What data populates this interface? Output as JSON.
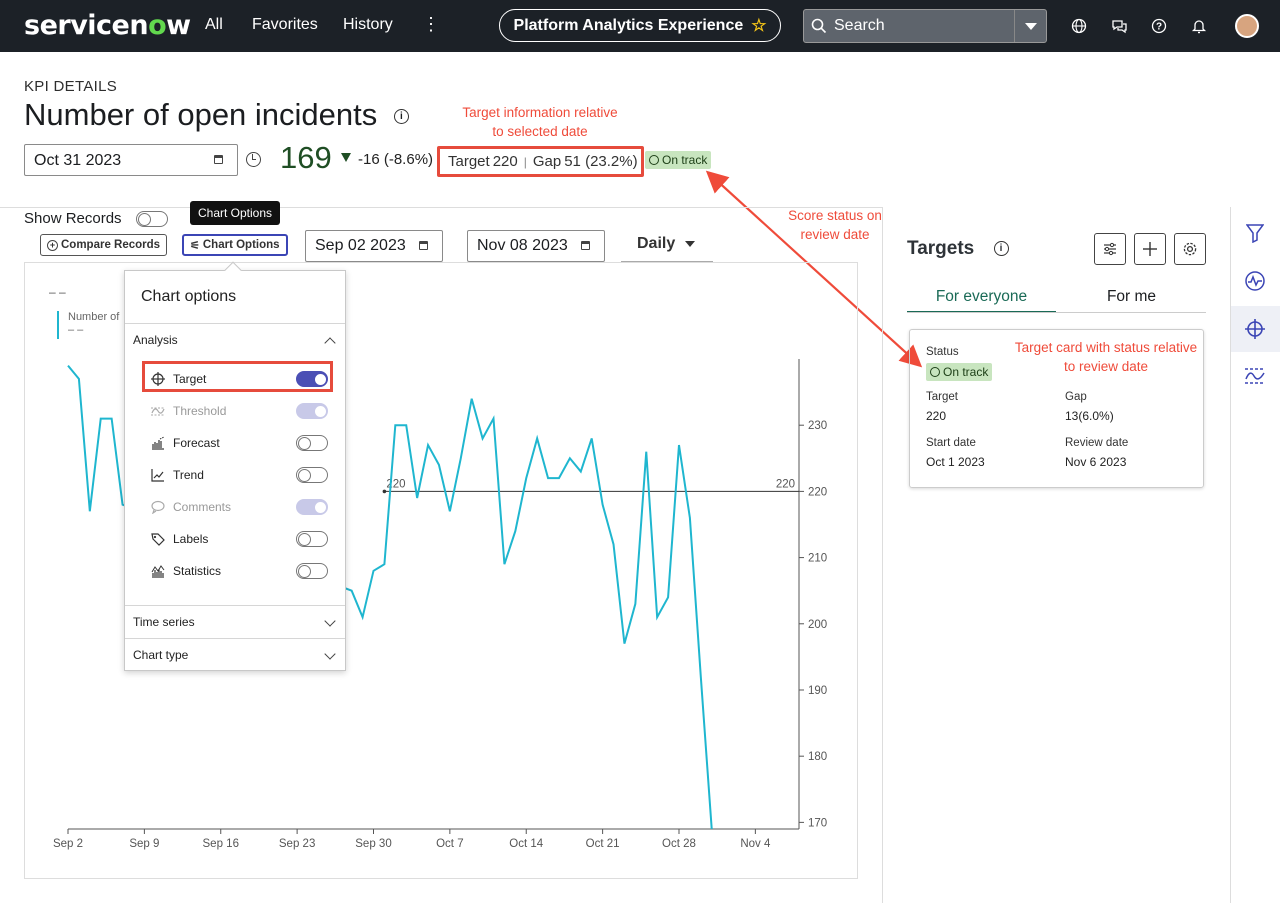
{
  "nav": {
    "brand_a": "servicen",
    "brand_o": "o",
    "brand_b": "w",
    "all": "All",
    "favorites": "Favorites",
    "history": "History",
    "more": "⋮",
    "app_title": "Platform Analytics Experience",
    "search_placeholder": "Search"
  },
  "header": {
    "section_label": "KPI DETAILS",
    "title": "Number of open incidents",
    "date": "Oct 31 2023",
    "score": "169",
    "change": "-16 (-8.6%)",
    "target_label": "Target",
    "target_value": "220",
    "gap_label": "Gap",
    "gap_value": "51 (23.2%)",
    "status": "On track"
  },
  "annotations": {
    "target_info_line1": "Target information relative",
    "target_info_line2": "to selected date",
    "score_status_line1": "Score status on",
    "score_status_line2": "review date",
    "card_status_line1": "Target card with status relative",
    "card_status_line2": "to review date"
  },
  "toolbar": {
    "show_records": "Show Records",
    "tooltip": "Chart Options",
    "compare_records": "Compare Records",
    "chart_options": "Chart Options",
    "start_date": "Sep 02 2023",
    "end_date": "Nov 08 2023",
    "frequency": "Daily"
  },
  "popover": {
    "title": "Chart options",
    "analysis": "Analysis",
    "options": [
      {
        "label": "Target",
        "state": "on"
      },
      {
        "label": "Threshold",
        "state": "disabled"
      },
      {
        "label": "Forecast",
        "state": "off"
      },
      {
        "label": "Trend",
        "state": "off"
      },
      {
        "label": "Comments",
        "state": "disabled"
      },
      {
        "label": "Labels",
        "state": "off"
      },
      {
        "label": "Statistics",
        "state": "off"
      }
    ],
    "time_series": "Time series",
    "chart_type": "Chart type"
  },
  "chart_data": {
    "type": "line",
    "legend_dash": "– –",
    "legend_name": "Number of",
    "legend_sub": "– –",
    "series_color": "#1fb6cf",
    "x_ticks": [
      "Sep 2",
      "Sep 9",
      "Sep 16",
      "Sep 23",
      "Sep 30",
      "Oct 7",
      "Oct 14",
      "Oct 21",
      "Oct 28",
      "Nov 4"
    ],
    "y_ticks": [
      "170",
      "180",
      "190",
      "200",
      "210",
      "220",
      "230"
    ],
    "ylim": [
      169,
      240
    ],
    "target_value": 220,
    "target_label_left": "220",
    "target_label_right": "220",
    "target_start_day": 29,
    "x_start": "2023-09-02",
    "x_end": "2023-11-08",
    "points": [
      [
        0,
        239
      ],
      [
        1,
        237
      ],
      [
        2,
        217
      ],
      [
        3,
        231
      ],
      [
        4,
        231
      ],
      [
        5,
        218
      ],
      [
        26,
        205
      ],
      [
        27,
        201
      ],
      [
        28,
        208
      ],
      [
        29,
        209
      ],
      [
        30,
        230
      ],
      [
        31,
        230
      ],
      [
        32,
        219
      ],
      [
        33,
        227
      ],
      [
        34,
        224
      ],
      [
        35,
        217
      ],
      [
        36,
        225
      ],
      [
        37,
        234
      ],
      [
        38,
        228
      ],
      [
        39,
        231
      ],
      [
        40,
        209
      ],
      [
        41,
        214
      ],
      [
        42,
        222
      ],
      [
        43,
        228
      ],
      [
        44,
        222
      ],
      [
        45,
        222
      ],
      [
        46,
        225
      ],
      [
        47,
        223
      ],
      [
        48,
        228
      ],
      [
        49,
        218
      ],
      [
        50,
        212
      ],
      [
        51,
        197
      ],
      [
        52,
        203
      ],
      [
        53,
        226
      ],
      [
        54,
        201
      ],
      [
        55,
        204
      ],
      [
        56,
        227
      ],
      [
        57,
        216
      ],
      [
        58,
        192
      ],
      [
        59,
        169
      ]
    ]
  },
  "targets_panel": {
    "title": "Targets",
    "tab_everyone": "For everyone",
    "tab_me": "For me",
    "card": {
      "status_label": "Status",
      "status": "On track",
      "target_label": "Target",
      "target": "220",
      "gap_label": "Gap",
      "gap": "13(6.0%)",
      "start_label": "Start date",
      "start": "Oct 1 2023",
      "review_label": "Review date",
      "review": "Nov 6 2023"
    }
  },
  "colors": {
    "nav_bg": "#1c2127",
    "accent_green": "#1a6a56",
    "annotation_red": "#ef4b3a",
    "highlight_red": "#e64b3c",
    "toggle_on": "#4b4fb5",
    "status_bg": "#c8e5bf"
  },
  "icons": [
    "search-icon",
    "globe-icon",
    "chat-icon",
    "help-icon",
    "bell-icon",
    "star-icon",
    "calendar-icon",
    "clock-icon",
    "info-icon",
    "filter-icon",
    "activity-icon",
    "target-crosshair-icon",
    "threshold-icon",
    "settings-icon",
    "plus-icon",
    "sliders-icon"
  ]
}
